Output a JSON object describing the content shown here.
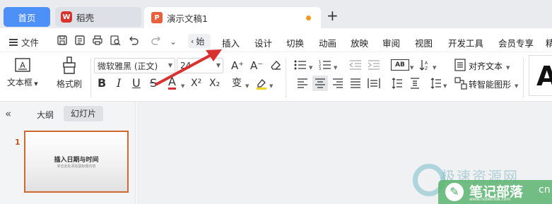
{
  "tabs": {
    "home": "首页",
    "daoke": "稻壳",
    "doc": "演示文稿1",
    "add": "+"
  },
  "menu": {
    "file": "文件",
    "back": "始",
    "items": [
      "插入",
      "设计",
      "切换",
      "动画",
      "放映",
      "审阅",
      "视图",
      "开发工具",
      "会员专享",
      "精"
    ]
  },
  "ribbon": {
    "textbox": "文本框",
    "format_painter": "格式刷",
    "font_name": "微软雅黑 (正文)",
    "font_size": "24",
    "align_text": "对齐文本",
    "smart_shape": "转智能图形",
    "increase_font": "A⁺",
    "decrease_font": "A⁻",
    "bold": "B",
    "italic": "I",
    "underline": "U",
    "strike": "S",
    "font_color": "A",
    "superscript": "X²",
    "subscript": "X₂",
    "phonetic": "变",
    "big_letter": "A"
  },
  "left_panel": {
    "outline": "大纲",
    "slides": "幻灯片",
    "slide_number": "1",
    "thumb_title": "插入日期与时间",
    "thumb_subtitle": "单击此处添加副标题内容"
  },
  "watermark": {
    "top": "极速资源网",
    "badge": "笔记部落",
    "url": "www.notetribe.com",
    "tld": "cn"
  },
  "colors": {
    "home_tab": "#4d90f7",
    "slide_border": "#d0692f",
    "arrow": "#d93030",
    "unsaved_dot": "#f29a1f"
  }
}
